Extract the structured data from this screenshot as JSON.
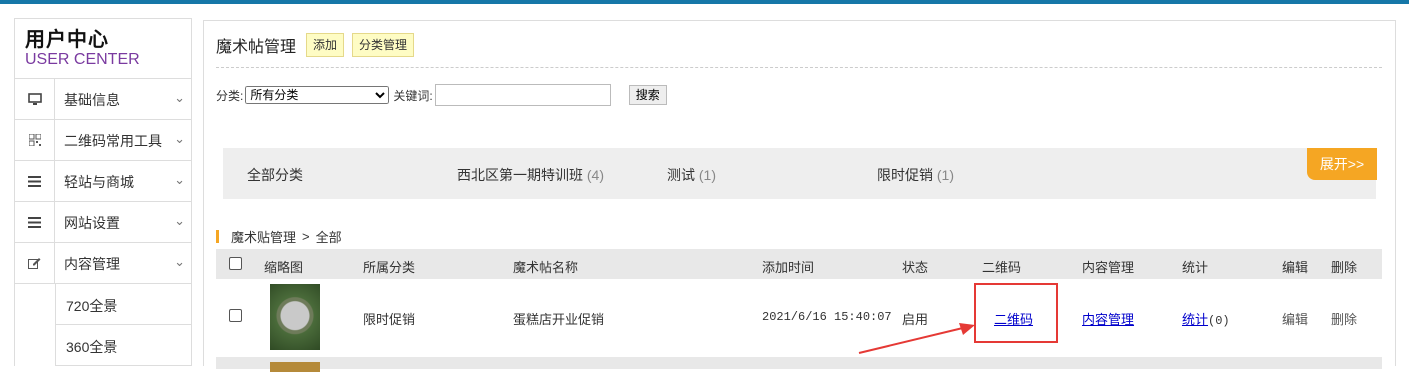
{
  "sidebar": {
    "title": "用户中心",
    "subtitle": "USER CENTER",
    "items": [
      {
        "label": "基础信息",
        "icon": "monitor-icon"
      },
      {
        "label": "二维码常用工具",
        "icon": "qrcode-icon"
      },
      {
        "label": "轻站与商城",
        "icon": "menu-icon"
      },
      {
        "label": "网站设置",
        "icon": "menu-icon"
      },
      {
        "label": "内容管理",
        "icon": "edit-icon"
      }
    ],
    "sub_items": [
      "720全景",
      "360全景"
    ]
  },
  "main": {
    "title": "魔术帖管理",
    "add_label": "添加",
    "category_manage_label": "分类管理",
    "filter": {
      "category_label": "分类:",
      "category_selected": "所有分类",
      "keyword_label": "关键词:",
      "keyword_value": "",
      "search_label": "搜索"
    },
    "categories": [
      {
        "name": "全部分类",
        "count": ""
      },
      {
        "name": "西北区第一期特训班",
        "count": "(4)"
      },
      {
        "name": "测试",
        "count": "(1)"
      },
      {
        "name": "限时促销",
        "count": "(1)"
      }
    ],
    "expand_label": "展开>>",
    "breadcrumb": {
      "root": "魔术贴管理",
      "sep": ">",
      "current": "全部"
    },
    "table": {
      "headers": [
        "缩略图",
        "所属分类",
        "魔术帖名称",
        "添加时间",
        "状态",
        "二维码",
        "内容管理",
        "统计",
        "编辑",
        "删除"
      ],
      "rows": [
        {
          "category": "限时促销",
          "name": "蛋糕店开业促销",
          "time": "2021/6/16 15:40:07",
          "status": "启用",
          "qrcode": "二维码",
          "content": "内容管理",
          "stats_label": "统计",
          "stats_count": "(0)",
          "edit": "编辑",
          "delete": "删除"
        }
      ]
    }
  },
  "colors": {
    "accent": "#f5a623",
    "topbar": "#1677a8",
    "highlight": "#e53935",
    "brand_sub": "#7a3aa0"
  }
}
